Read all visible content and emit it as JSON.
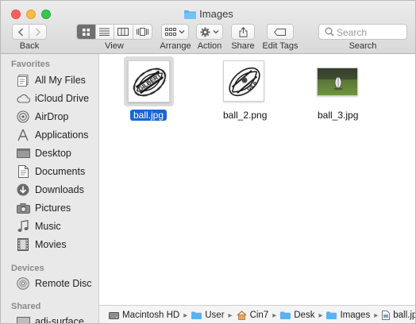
{
  "window": {
    "title": "Images"
  },
  "toolbar": {
    "back_label": "Back",
    "view_label": "View",
    "arrange_label": "Arrange",
    "action_label": "Action",
    "share_label": "Share",
    "edit_tags_label": "Edit Tags",
    "search_label": "Search",
    "search_placeholder": "Search",
    "active_view": "icon"
  },
  "sidebar": {
    "favorites_header": "Favorites",
    "favorites": [
      {
        "label": "All My Files",
        "icon": "all-files-icon"
      },
      {
        "label": "iCloud Drive",
        "icon": "cloud-icon"
      },
      {
        "label": "AirDrop",
        "icon": "airdrop-icon"
      },
      {
        "label": "Applications",
        "icon": "applications-icon"
      },
      {
        "label": "Desktop",
        "icon": "desktop-icon"
      },
      {
        "label": "Documents",
        "icon": "documents-icon"
      },
      {
        "label": "Downloads",
        "icon": "downloads-icon"
      },
      {
        "label": "Pictures",
        "icon": "pictures-icon"
      },
      {
        "label": "Music",
        "icon": "music-icon"
      },
      {
        "label": "Movies",
        "icon": "movies-icon"
      }
    ],
    "devices_header": "Devices",
    "devices": [
      {
        "label": "Remote Disc",
        "icon": "disc-icon"
      }
    ],
    "shared_header": "Shared",
    "shared": [
      {
        "label": "adi-surface",
        "icon": "network-icon"
      }
    ]
  },
  "files": [
    {
      "name": "ball.jpg",
      "selected": true,
      "thumb_text": "GILBERT"
    },
    {
      "name": "ball_2.png",
      "selected": false,
      "thumb_text": "GILB"
    },
    {
      "name": "ball_3.jpg",
      "selected": false
    }
  ],
  "pathbar": [
    {
      "label": "Macintosh HD",
      "icon": "hard-drive-icon"
    },
    {
      "label": "User",
      "icon": "folder-icon"
    },
    {
      "label": "Cin7",
      "icon": "home-icon"
    },
    {
      "label": "Desk",
      "icon": "folder-icon"
    },
    {
      "label": "Images",
      "icon": "folder-icon"
    },
    {
      "label": "ball.jpg",
      "icon": "file-icon"
    }
  ],
  "colors": {
    "selection": "#1a64d6",
    "folder": "#5ab2ee",
    "sidebar_bg": "#e9e9e9",
    "toolbar_bg": "#dedede"
  }
}
